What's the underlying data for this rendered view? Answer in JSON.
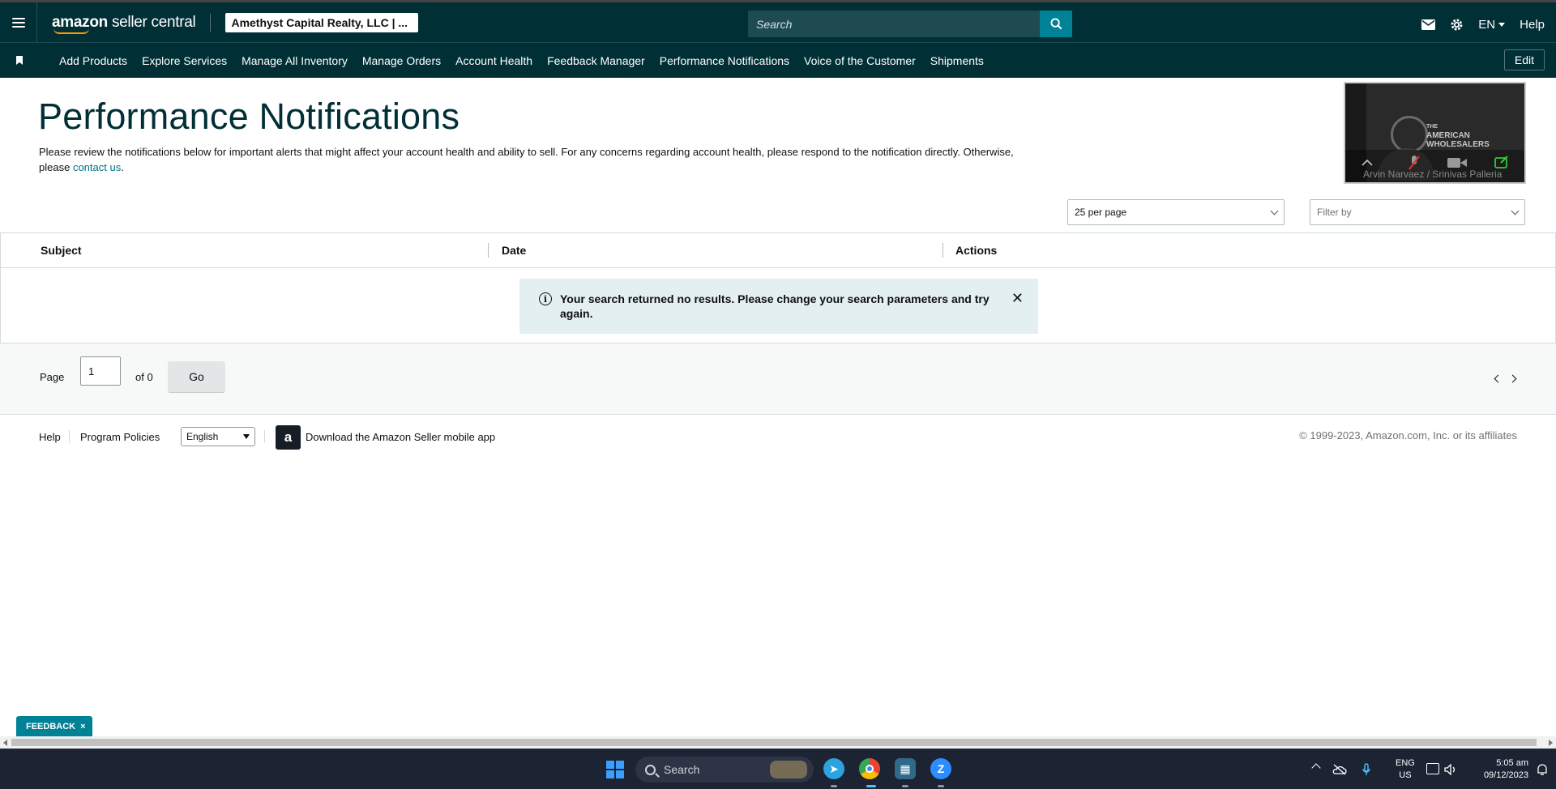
{
  "header": {
    "logo_brand": "amazon",
    "logo_product": "seller central",
    "account": "Amethyst Capital Realty, LLC | ...",
    "search_placeholder": "Search",
    "language": "EN",
    "help": "Help"
  },
  "nav": {
    "items": [
      "Add Products",
      "Explore Services",
      "Manage All Inventory",
      "Manage Orders",
      "Account Health",
      "Feedback Manager",
      "Performance Notifications",
      "Voice of the Customer",
      "Shipments"
    ],
    "edit": "Edit"
  },
  "page": {
    "title": "Performance Notifications",
    "description": "Please review the notifications below for important alerts that might affect your account health and ability to sell. For any concerns regarding account health, please respond to the notification directly. Otherwise, please",
    "contact_link": "contact us",
    "description_end": "."
  },
  "video": {
    "brand_line1": "THE",
    "brand_line2": "AMERICAN",
    "brand_line3": "WHOLESALERS",
    "participants": "Arvin Narvaez / Srinivas  Palleria"
  },
  "controls": {
    "per_page": "25 per page",
    "filter_placeholder": "Filter by"
  },
  "table": {
    "columns": [
      "Subject",
      "Date",
      "Actions"
    ],
    "alert_message": "Your search returned no results. Please change your search parameters and try again."
  },
  "pager": {
    "page_label": "Page",
    "page_value": "1",
    "of_label": "of 0",
    "go": "Go"
  },
  "footer": {
    "help": "Help",
    "policies": "Program Policies",
    "language": "English",
    "app_text": "Download the Amazon Seller mobile app",
    "copyright": "© 1999-2023, Amazon.com, Inc. or its affiliates"
  },
  "feedback": {
    "label": "FEEDBACK",
    "close": "×"
  },
  "taskbar": {
    "search": "Search",
    "lang_line1": "ENG",
    "lang_line2": "US",
    "time": "5:05 am",
    "date": "09/12/2023"
  },
  "colors": {
    "header_bg": "#002f36",
    "accent": "#008296",
    "link": "#007185",
    "alert_bg": "#e3eff0"
  }
}
